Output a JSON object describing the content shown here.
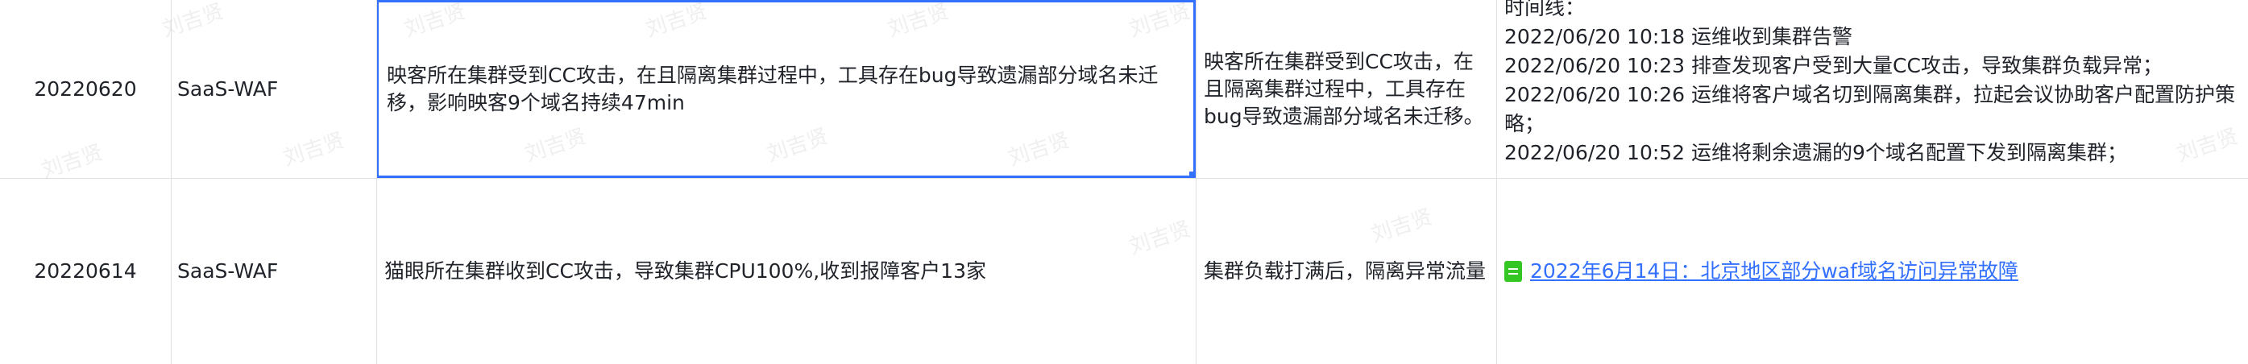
{
  "watermark_text": "刘吉贤",
  "rows": [
    {
      "date": "20220620",
      "product": "SaaS-WAF",
      "description": "映客所在集群受到CC攻击，在且隔离集群过程中，工具存在bug导致遗漏部分域名未迁移，影响映客9个域名持续47min",
      "reason": "映客所在集群受到CC攻击，在且隔离集群过程中，工具存在bug导致遗漏部分域名未迁移。",
      "timeline": [
        "时间线：",
        "2022/06/20 10:18 运维收到集群告警",
        "2022/06/20 10:23 排查发现客户受到大量CC攻击，导致集群负载异常；",
        "2022/06/20 10:26 运维将客户域名切到隔离集群，拉起会议协助客户配置防护策略；",
        "2022/06/20 10:52 运维将剩余遗漏的9个域名配置下发到隔离集群；"
      ]
    },
    {
      "date": "20220614",
      "product": "SaaS-WAF",
      "description": "猫眼所在集群收到CC攻击，导致集群CPU100%,收到报障客户13家",
      "reason": "集群负载打满后，隔离异常流量",
      "doc_link": "2022年6月14日：北京地区部分waf域名访问异常故障",
      "doc_icon": "sheet-doc-icon"
    }
  ],
  "colors": {
    "selection": "#3370ff",
    "link": "#3370ff",
    "grid": "#dee0e3",
    "doc_icon": "#34c724"
  }
}
